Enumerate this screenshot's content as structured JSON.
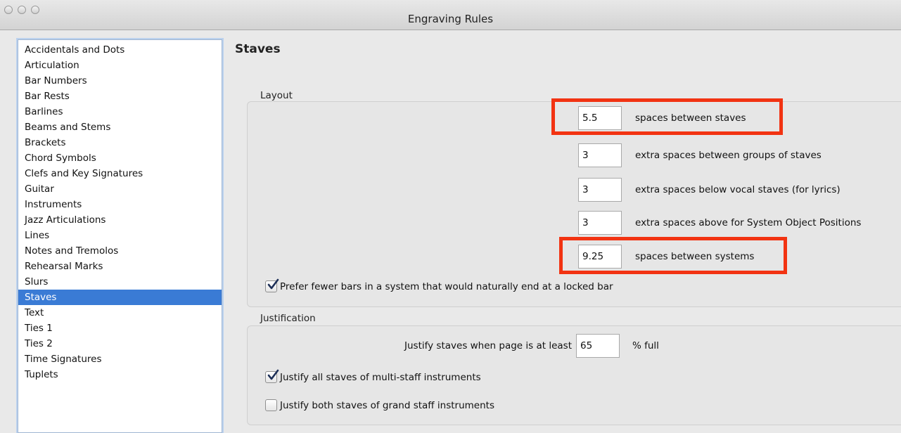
{
  "window": {
    "title": "Engraving Rules"
  },
  "sidebar": {
    "items": [
      {
        "label": "Accidentals and Dots"
      },
      {
        "label": "Articulation"
      },
      {
        "label": "Bar Numbers"
      },
      {
        "label": "Bar Rests"
      },
      {
        "label": "Barlines"
      },
      {
        "label": "Beams and Stems"
      },
      {
        "label": "Brackets"
      },
      {
        "label": "Chord Symbols"
      },
      {
        "label": "Clefs and Key Signatures"
      },
      {
        "label": "Guitar"
      },
      {
        "label": "Instruments"
      },
      {
        "label": "Jazz Articulations"
      },
      {
        "label": "Lines"
      },
      {
        "label": "Notes and Tremolos"
      },
      {
        "label": "Rehearsal Marks"
      },
      {
        "label": "Slurs"
      },
      {
        "label": "Staves",
        "selected": true
      },
      {
        "label": "Text"
      },
      {
        "label": "Ties 1"
      },
      {
        "label": "Ties 2"
      },
      {
        "label": "Time Signatures"
      },
      {
        "label": "Tuplets"
      }
    ]
  },
  "main": {
    "heading": "Staves",
    "layout": {
      "label": "Layout",
      "fields": [
        {
          "value": "5.5",
          "text": "spaces between staves"
        },
        {
          "value": "3",
          "text": "extra spaces between groups of staves"
        },
        {
          "value": "3",
          "text": "extra spaces below vocal staves (for lyrics)"
        },
        {
          "value": "3",
          "text": "extra spaces above for System Object Positions"
        },
        {
          "value": "9.25",
          "text": "spaces between systems"
        }
      ],
      "prefer_fewer_bars": {
        "label": "Prefer fewer bars in a system that would naturally end at a locked bar",
        "checked": true
      }
    },
    "justification": {
      "label": "Justification",
      "justify_prefix": "Justify staves when page is at least",
      "justify_value": "65",
      "justify_suffix": "% full",
      "justify_all": {
        "label": "Justify all staves of multi-staff instruments",
        "checked": true
      },
      "justify_grand": {
        "label": "Justify both staves of grand staff instruments",
        "checked": false
      }
    }
  },
  "colors": {
    "highlight": "#f23312",
    "selection": "#3a7bd5"
  }
}
